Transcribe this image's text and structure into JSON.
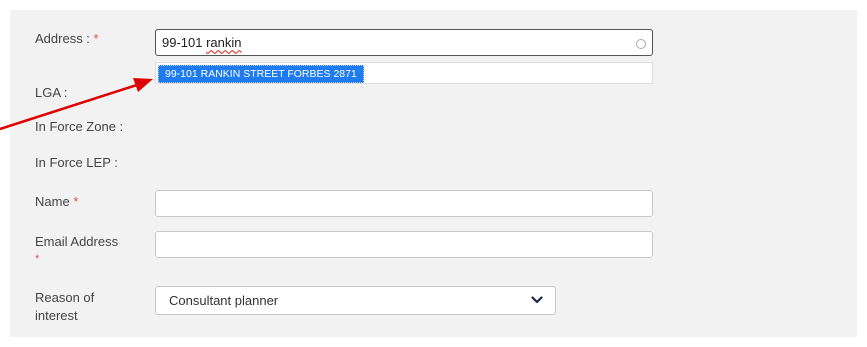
{
  "form": {
    "address": {
      "label": "Address :",
      "required_mark": "*",
      "value_prefix": "99-101 ",
      "value_misspelled": "rankin",
      "suggestions": [
        "99-101 RANKIN STREET FORBES 2871"
      ]
    },
    "lga": {
      "label": "LGA :"
    },
    "in_force_zone": {
      "label": "In Force Zone :"
    },
    "in_force_lep": {
      "label": "In Force LEP :"
    },
    "name": {
      "label": "Name",
      "required_mark": "*",
      "value": ""
    },
    "email": {
      "label": "Email Address",
      "required_mark": "*",
      "value": ""
    },
    "reason": {
      "label_line1": "Reason of",
      "label_line2": "interest",
      "selected": "Consultant planner"
    }
  },
  "colors": {
    "panel_bg": "#f2f2f2",
    "required": "#d9534f",
    "highlight": "#1e7bf2",
    "annotation_arrow": "#e00000"
  },
  "icons": {
    "address_status": "spinner-icon",
    "select_toggle": "chevron-down-icon"
  }
}
